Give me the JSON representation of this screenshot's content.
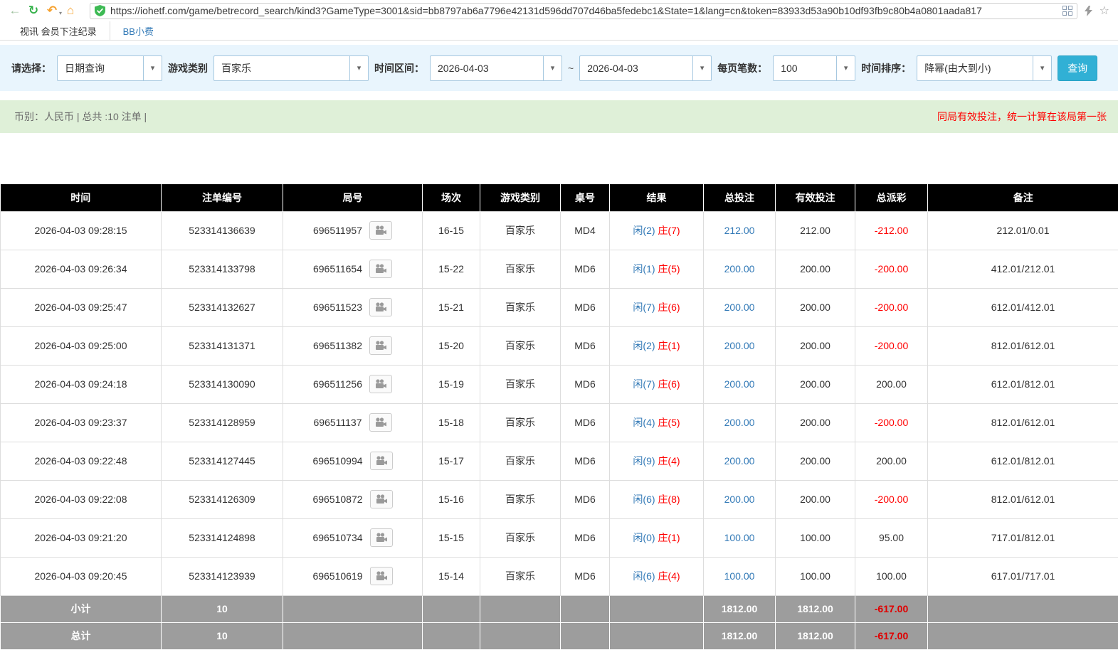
{
  "browser": {
    "url": "https://iohetf.com/game/betrecord_search/kind3?GameType=3001&sid=bb8797ab6a7796e42131d596dd707d46ba5fedebc1&State=1&lang=cn&token=83933d53a90b10df93fb9c80b4a0801aada817"
  },
  "tabs": {
    "record_tab": "视讯 会员下注纪录",
    "tip_tab": "BB小费"
  },
  "filters": {
    "select_label": "请选择：",
    "query_type": "日期查询",
    "game_type_label": "游戏类别",
    "game_type": "百家乐",
    "time_range_label": "时间区间：",
    "date_from": "2026-04-03",
    "tilde": "~",
    "date_to": "2026-04-03",
    "per_page_label": "每页笔数：",
    "per_page": "100",
    "sort_label": "时间排序：",
    "sort_order": "降幂(由大到小)",
    "search_button": "查询"
  },
  "summary": {
    "left_text": "币别：人民币 | 总共 :10 注单 |",
    "right_notice": "同局有效投注，统一计算在该局第一张"
  },
  "table": {
    "headers": [
      "时间",
      "注单编号",
      "局号",
      "场次",
      "游戏类别",
      "桌号",
      "结果",
      "总投注",
      "有效投注",
      "总派彩",
      "备注"
    ],
    "rows": [
      {
        "time": "2026-04-03 09:28:15",
        "bet_no": "523314136639",
        "round_no": "696511957",
        "session": "16-15",
        "game_type": "百家乐",
        "table_no": "MD4",
        "result_player": "闲(2)",
        "result_banker": "庄(7)",
        "total_bet": "212.00",
        "valid_bet": "212.00",
        "payout": "-212.00",
        "note": "212.01/0.01"
      },
      {
        "time": "2026-04-03 09:26:34",
        "bet_no": "523314133798",
        "round_no": "696511654",
        "session": "15-22",
        "game_type": "百家乐",
        "table_no": "MD6",
        "result_player": "闲(1)",
        "result_banker": "庄(5)",
        "total_bet": "200.00",
        "valid_bet": "200.00",
        "payout": "-200.00",
        "note": "412.01/212.01"
      },
      {
        "time": "2026-04-03 09:25:47",
        "bet_no": "523314132627",
        "round_no": "696511523",
        "session": "15-21",
        "game_type": "百家乐",
        "table_no": "MD6",
        "result_player": "闲(7)",
        "result_banker": "庄(6)",
        "total_bet": "200.00",
        "valid_bet": "200.00",
        "payout": "-200.00",
        "note": "612.01/412.01"
      },
      {
        "time": "2026-04-03 09:25:00",
        "bet_no": "523314131371",
        "round_no": "696511382",
        "session": "15-20",
        "game_type": "百家乐",
        "table_no": "MD6",
        "result_player": "闲(2)",
        "result_banker": "庄(1)",
        "total_bet": "200.00",
        "valid_bet": "200.00",
        "payout": "-200.00",
        "note": "812.01/612.01"
      },
      {
        "time": "2026-04-03 09:24:18",
        "bet_no": "523314130090",
        "round_no": "696511256",
        "session": "15-19",
        "game_type": "百家乐",
        "table_no": "MD6",
        "result_player": "闲(7)",
        "result_banker": "庄(6)",
        "total_bet": "200.00",
        "valid_bet": "200.00",
        "payout": "200.00",
        "note": "612.01/812.01"
      },
      {
        "time": "2026-04-03 09:23:37",
        "bet_no": "523314128959",
        "round_no": "696511137",
        "session": "15-18",
        "game_type": "百家乐",
        "table_no": "MD6",
        "result_player": "闲(4)",
        "result_banker": "庄(5)",
        "total_bet": "200.00",
        "valid_bet": "200.00",
        "payout": "-200.00",
        "note": "812.01/612.01"
      },
      {
        "time": "2026-04-03 09:22:48",
        "bet_no": "523314127445",
        "round_no": "696510994",
        "session": "15-17",
        "game_type": "百家乐",
        "table_no": "MD6",
        "result_player": "闲(9)",
        "result_banker": "庄(4)",
        "total_bet": "200.00",
        "valid_bet": "200.00",
        "payout": "200.00",
        "note": "612.01/812.01"
      },
      {
        "time": "2026-04-03 09:22:08",
        "bet_no": "523314126309",
        "round_no": "696510872",
        "session": "15-16",
        "game_type": "百家乐",
        "table_no": "MD6",
        "result_player": "闲(6)",
        "result_banker": "庄(8)",
        "total_bet": "200.00",
        "valid_bet": "200.00",
        "payout": "-200.00",
        "note": "812.01/612.01"
      },
      {
        "time": "2026-04-03 09:21:20",
        "bet_no": "523314124898",
        "round_no": "696510734",
        "session": "15-15",
        "game_type": "百家乐",
        "table_no": "MD6",
        "result_player": "闲(0)",
        "result_banker": "庄(1)",
        "total_bet": "100.00",
        "valid_bet": "100.00",
        "payout": "95.00",
        "note": "717.01/812.01"
      },
      {
        "time": "2026-04-03 09:20:45",
        "bet_no": "523314123939",
        "round_no": "696510619",
        "session": "15-14",
        "game_type": "百家乐",
        "table_no": "MD6",
        "result_player": "闲(6)",
        "result_banker": "庄(4)",
        "total_bet": "100.00",
        "valid_bet": "100.00",
        "payout": "100.00",
        "note": "617.01/717.01"
      }
    ],
    "footer_rows": [
      {
        "label": "小计",
        "count": "10",
        "total_bet": "1812.00",
        "valid_bet": "1812.00",
        "payout": "-617.00"
      },
      {
        "label": "总计",
        "count": "10",
        "total_bet": "1812.00",
        "valid_bet": "1812.00",
        "payout": "-617.00"
      }
    ]
  }
}
